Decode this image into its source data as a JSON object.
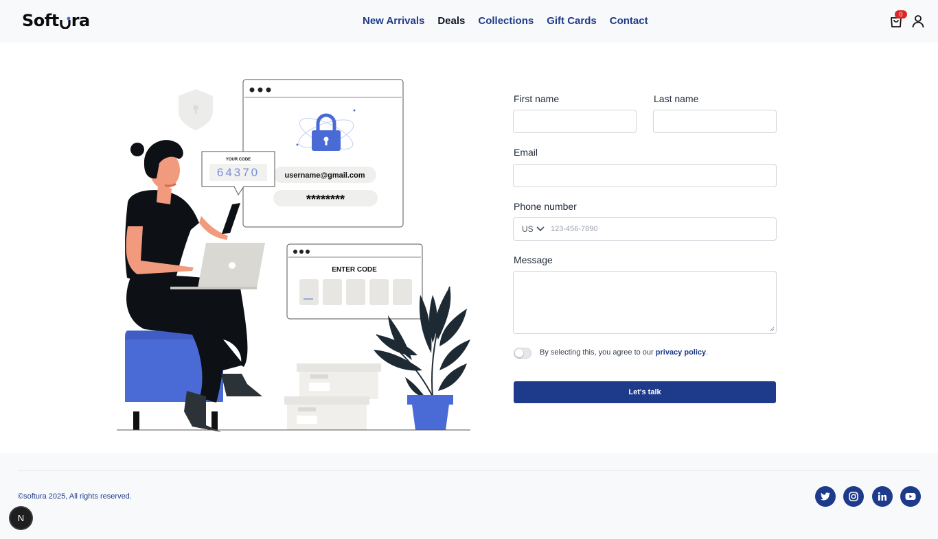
{
  "header": {
    "logo_left": "Soft",
    "logo_right": "ra",
    "nav": [
      "New Arrivals",
      "Deals",
      "Collections",
      "Gift Cards",
      "Contact"
    ],
    "cart_count": "0"
  },
  "illustration": {
    "code_label": "YOUR CODE",
    "code_value": "64370",
    "email": "username@gmail.com",
    "password": "********",
    "enter_code": "ENTER CODE"
  },
  "form": {
    "first_name_label": "First name",
    "last_name_label": "Last name",
    "email_label": "Email",
    "phone_label": "Phone number",
    "country_code": "US",
    "phone_placeholder": "123-456-7890",
    "message_label": "Message",
    "agree_prefix": "By selecting this, you agree to our ",
    "agree_link": "privacy policy",
    "agree_suffix": ".",
    "submit": "Let's talk"
  },
  "footer": {
    "copyright": "©softura 2025, All rights reserved.",
    "social": [
      "twitter-icon",
      "instagram-icon",
      "linkedin-icon",
      "youtube-icon"
    ]
  },
  "dev_badge": "N",
  "colors": {
    "brand": "#1e3a8a",
    "accent": "#4a6bd6",
    "badge": "#dc2626"
  }
}
